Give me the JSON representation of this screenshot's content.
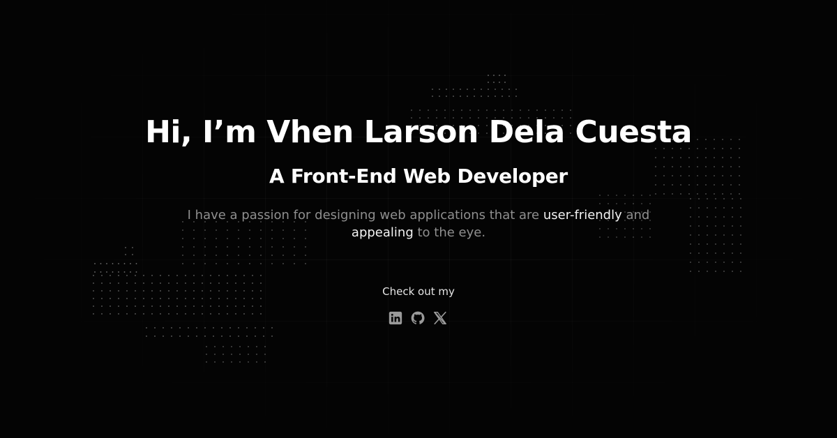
{
  "hero": {
    "title": "Hi, I’m Vhen Larson Dela Cuesta",
    "subtitle": "A Front-End Web Developer",
    "tagline": {
      "part1": "I have a passion for designing web applications that are ",
      "highlight1": "user-friendly",
      "part2": " and ",
      "highlight2": "appealing",
      "part3": " to the eye."
    }
  },
  "social": {
    "heading": "Check out my",
    "links": [
      {
        "icon": "linkedin-icon"
      },
      {
        "icon": "github-icon"
      },
      {
        "icon": "x-icon"
      }
    ]
  },
  "colors": {
    "background": "#040404",
    "text": "#ffffff",
    "muted_text": "#8f8f8f",
    "icon": "#9a9a9a"
  }
}
